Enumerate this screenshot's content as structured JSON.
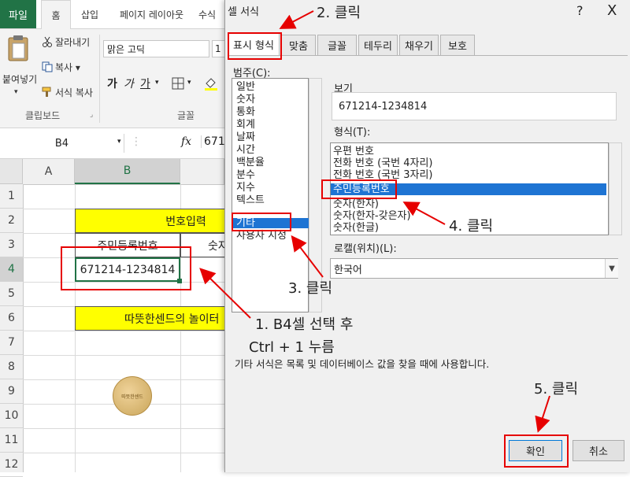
{
  "ribbon": {
    "tabs": [
      "파일",
      "홈",
      "삽입",
      "페이지 레이아웃",
      "수식"
    ],
    "clipboard": {
      "cut": "잘라내기",
      "copy": "복사 ▾",
      "format_painter": "서식 복사",
      "paste": "붙여넣기",
      "group_label": "클립보드"
    },
    "font": {
      "name": "맑은 고딕",
      "size": "1",
      "bold": "가",
      "italic": "가",
      "underline": "가",
      "group_label": "글꼴"
    }
  },
  "formula_bar": {
    "name_box": "B4",
    "fx": "fx",
    "value": "671"
  },
  "sheet": {
    "columns": [
      "A",
      "B"
    ],
    "rows": [
      "1",
      "2",
      "3",
      "4",
      "5",
      "6",
      "7",
      "8",
      "9",
      "10",
      "11",
      "12"
    ],
    "cells": {
      "b2": "번호입력",
      "b3": "주민등록번호",
      "c3": "숫자",
      "b4": "671214-1234814",
      "b6": "따뜻한센드의 놀이터"
    },
    "stamp_text": "따뜻한센드"
  },
  "dialog": {
    "title": "셀 서식",
    "help": "?",
    "close": "X",
    "tabs": [
      "표시 형식",
      "맞춤",
      "글꼴",
      "테두리",
      "채우기",
      "보호"
    ],
    "category_label": "범주(C):",
    "categories": [
      "일반",
      "숫자",
      "통화",
      "회계",
      "날짜",
      "시간",
      "백분율",
      "분수",
      "지수",
      "텍스트",
      "기타",
      "사용자 지정"
    ],
    "selected_category": "기타",
    "sample_label": "보기",
    "sample_value": "671214-1234814",
    "type_label": "형식(T):",
    "types": [
      "우편 번호",
      "전화 번호 (국번 4자리)",
      "전화 번호 (국번 3자리)",
      "주민등록번호",
      "숫자(한자)",
      "숫자(한자-갖은자)",
      "숫자(한글)"
    ],
    "selected_type": "주민등록번호",
    "locale_label": "로캘(위치)(L):",
    "locale_value": "한국어",
    "description": "기타 서식은 목록 및 데이터베이스 값을 찾을 때에 사용합니다.",
    "ok": "확인",
    "cancel": "취소"
  },
  "annotations": {
    "step1_line1": "1. B4셀 선택 후",
    "step1_line2": "Ctrl + 1 누름",
    "step2": "2. 클릭",
    "step3": "3. 클릭",
    "step4": "4. 클릭",
    "step5": "5. 클릭"
  },
  "colors": {
    "excel_green": "#217346",
    "highlight_yellow": "#ffff00",
    "selection_blue": "#1e74d3",
    "annotation_red": "#e60000"
  }
}
